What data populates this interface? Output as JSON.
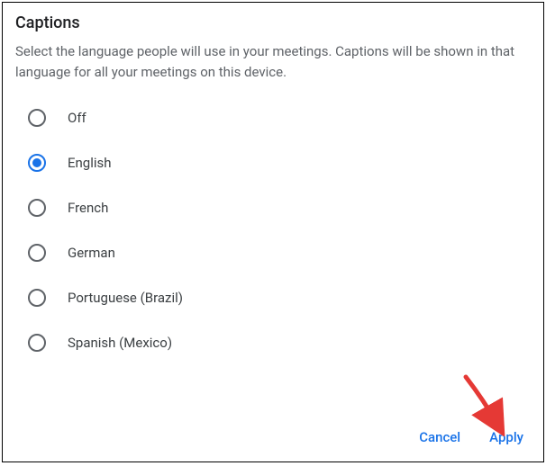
{
  "title": "Captions",
  "description": "Select the language people will use in your meetings. Captions will be shown in that language for all your meetings on this device.",
  "options": [
    {
      "label": "Off",
      "selected": false
    },
    {
      "label": "English",
      "selected": true
    },
    {
      "label": "French",
      "selected": false
    },
    {
      "label": "German",
      "selected": false
    },
    {
      "label": "Portuguese (Brazil)",
      "selected": false
    },
    {
      "label": "Spanish (Mexico)",
      "selected": false
    }
  ],
  "buttons": {
    "cancel": "Cancel",
    "apply": "Apply"
  }
}
